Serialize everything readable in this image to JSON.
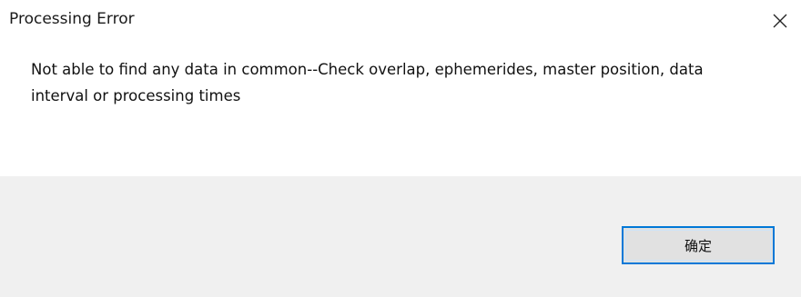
{
  "dialog": {
    "title": "Processing Error",
    "close_icon": "close-icon",
    "message": "Not able to find any data in common--Check overlap, ephemerides, master position, data interval or processing times",
    "ok_label": "确定"
  },
  "colors": {
    "footer_bg": "#f0f0f0",
    "button_bg": "#e1e1e1",
    "button_border": "#0078d7"
  }
}
